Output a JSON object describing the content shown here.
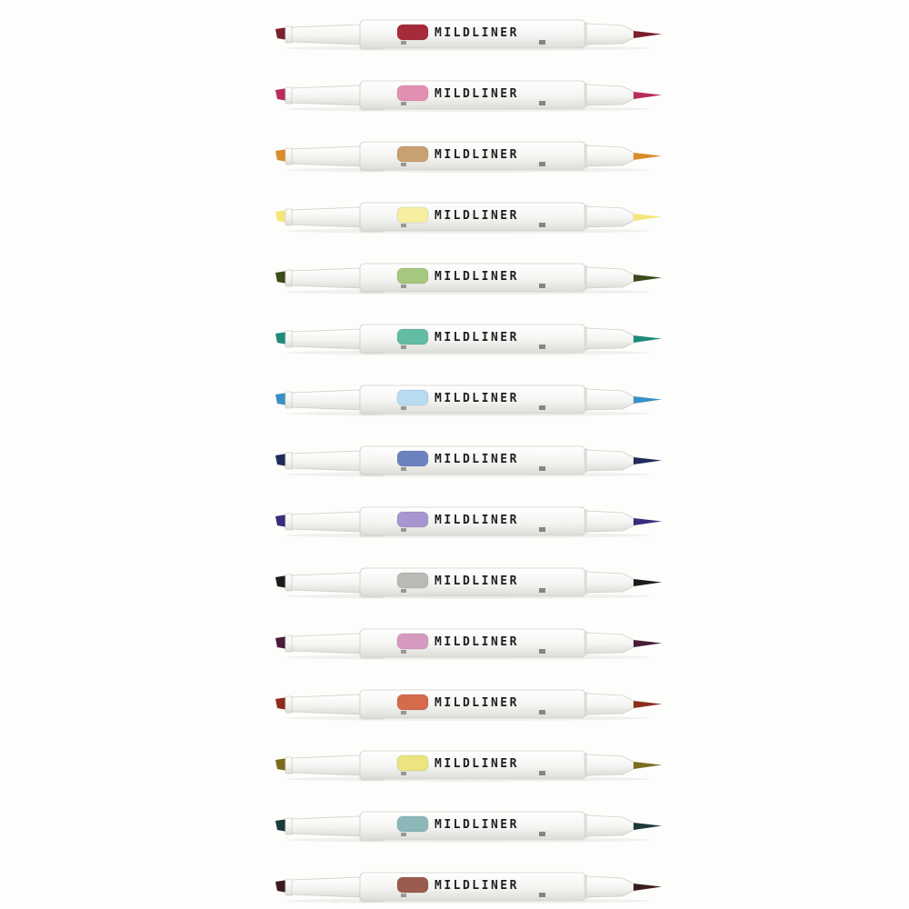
{
  "image": {
    "description_label": ""
  },
  "markers": [
    {
      "brand_text": "MILDLINER",
      "main_color": "#7a1f2c",
      "body_color": "#a52a3a"
    },
    {
      "brand_text": "MILDLINER",
      "main_color": "#b72c5a",
      "body_color": "#e38fb2"
    },
    {
      "brand_text": "MILDLINER",
      "main_color": "#d88c2c",
      "body_color": "#c9a071"
    },
    {
      "brand_text": "MILDLINER",
      "main_color": "#f4e77a",
      "body_color": "#f6ef9f"
    },
    {
      "brand_text": "MILDLINER",
      "main_color": "#3a4a1a",
      "body_color": "#a5c77f"
    },
    {
      "brand_text": "MILDLINER",
      "main_color": "#1f8a7c",
      "body_color": "#62bca4"
    },
    {
      "brand_text": "MILDLINER",
      "main_color": "#3a8fc4",
      "body_color": "#b8dbf0"
    },
    {
      "brand_text": "MILDLINER",
      "main_color": "#1f2c5a",
      "body_color": "#6c82bf"
    },
    {
      "brand_text": "MILDLINER",
      "main_color": "#3c2a7a",
      "body_color": "#a796cf"
    },
    {
      "brand_text": "MILDLINER",
      "main_color": "#1c1c1c",
      "body_color": "#b9b9b5"
    },
    {
      "brand_text": "MILDLINER",
      "main_color": "#4a1c3a",
      "body_color": "#d69ac0"
    },
    {
      "brand_text": "MILDLINER",
      "main_color": "#8c2c1c",
      "body_color": "#d66a4c"
    },
    {
      "brand_text": "MILDLINER",
      "main_color": "#7a6c1c",
      "body_color": "#ece47e"
    },
    {
      "brand_text": "MILDLINER",
      "main_color": "#1c3a3a",
      "body_color": "#8ab8b8"
    },
    {
      "brand_text": "MILDLINER",
      "main_color": "#3a1c1c",
      "body_color": "#9a5c4c"
    }
  ]
}
